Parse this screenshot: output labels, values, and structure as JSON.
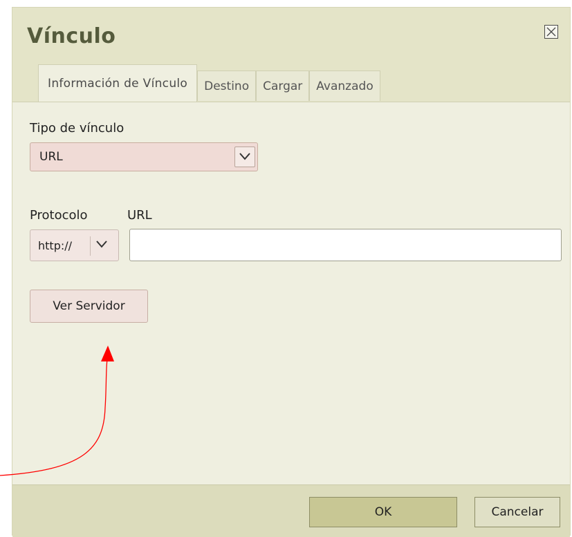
{
  "dialog": {
    "title": "Vínculo",
    "tabs": [
      {
        "label": "Información de Vínculo",
        "active": true
      },
      {
        "label": "Destino",
        "active": false
      },
      {
        "label": "Cargar",
        "active": false
      },
      {
        "label": "Avanzado",
        "active": false
      }
    ]
  },
  "form": {
    "link_type_label": "Tipo de vínculo",
    "link_type_value": "URL",
    "protocol_label": "Protocolo",
    "protocol_value": "http://",
    "url_label": "URL",
    "url_value": "",
    "browse_server_label": "Ver Servidor"
  },
  "footer": {
    "ok_label": "OK",
    "cancel_label": "Cancelar"
  },
  "icons": {
    "close": "close-icon",
    "dropdown": "chevron-down-icon",
    "annotation": "red-arrow-annotation"
  },
  "colors": {
    "dialog_bg": "#efefe0",
    "titlebar_bg": "#e4e4c8",
    "title_text": "#555b3c",
    "ok_button": "#c8c794",
    "annotation_arrow": "#ff0000"
  }
}
